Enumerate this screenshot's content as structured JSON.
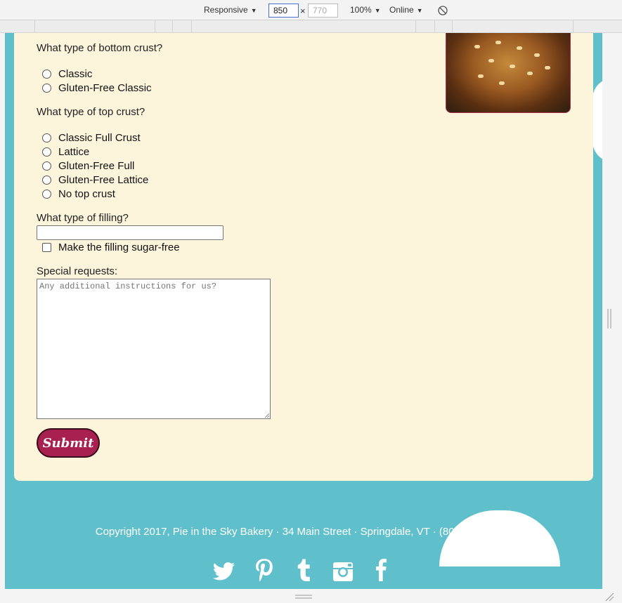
{
  "devtools": {
    "device": "Responsive",
    "width_value": "850",
    "height_placeholder": "770",
    "zoom": "100%",
    "network": "Online",
    "times": "×"
  },
  "form": {
    "bottom_crust_question": "What type of bottom crust?",
    "bottom_crust_options": [
      "Classic",
      "Gluten-Free Classic"
    ],
    "top_crust_question": "What type of top crust?",
    "top_crust_options": [
      "Classic Full Crust",
      "Lattice",
      "Gluten-Free Full",
      "Gluten-Free Lattice",
      "No top crust"
    ],
    "filling_question": "What type of filling?",
    "filling_value": "",
    "sugar_free_label": "Make the filling sugar-free",
    "special_requests_label": "Special requests:",
    "special_requests_placeholder": "Any additional instructions for us?",
    "submit_label": "Submit"
  },
  "footer": {
    "copyright": "Copyright 2017, Pie in the Sky Bakery · 34 Main Street · Springdale, VT · (802) 555-PIES",
    "social_icons": [
      "twitter-icon",
      "pinterest-icon",
      "tumblr-icon",
      "instagram-icon",
      "facebook-icon"
    ]
  },
  "colors": {
    "page_background": "#5fbfca",
    "card_background": "#fcf5dc",
    "submit_button": "#a8204f"
  }
}
